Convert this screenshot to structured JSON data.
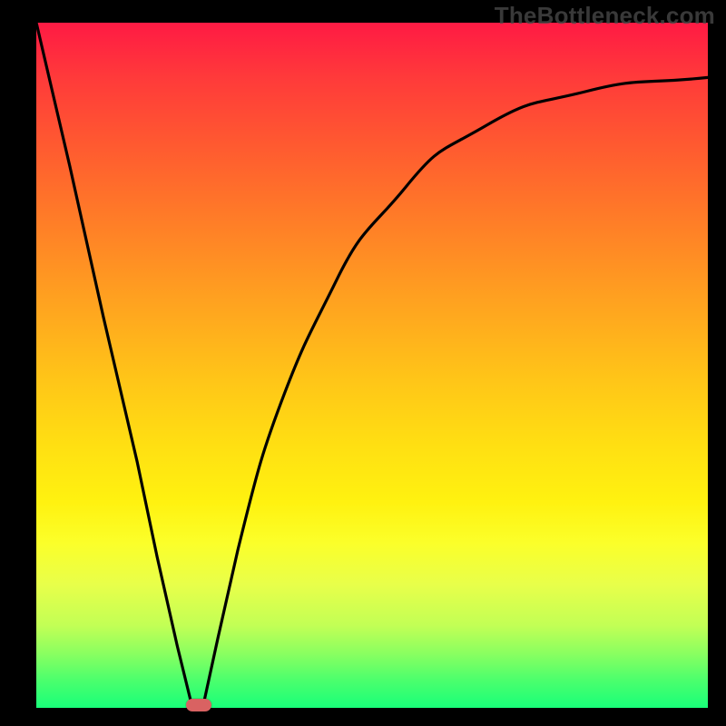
{
  "watermark": "TheBottleneck.com",
  "chart_data": {
    "type": "line",
    "title": "",
    "xlabel": "",
    "ylabel": "",
    "xlim": [
      0,
      1
    ],
    "ylim": [
      0,
      1
    ],
    "x": [
      0.0,
      0.05,
      0.1,
      0.15,
      0.18,
      0.21,
      0.23,
      0.25,
      0.27,
      0.3,
      0.33,
      0.37,
      0.41,
      0.45,
      0.5,
      0.55,
      0.6,
      0.67,
      0.74,
      0.82,
      0.9,
      1.0
    ],
    "values": [
      1.0,
      0.79,
      0.57,
      0.36,
      0.22,
      0.09,
      0.01,
      0.01,
      0.1,
      0.23,
      0.35,
      0.46,
      0.55,
      0.63,
      0.7,
      0.76,
      0.81,
      0.85,
      0.88,
      0.9,
      0.91,
      0.92
    ],
    "minimum_point": {
      "x": 0.24,
      "y": 0.0
    },
    "curve_description": "V-shaped curve: steep linear descent from top-left to a sharp minimum near x≈0.24 at bottom, then concave rise asymptotically approaching y≈0.92 toward the right edge.",
    "background": "vertical gradient red→orange→yellow→green (top to bottom)",
    "marker": {
      "shape": "rounded-rectangle",
      "color": "#d96262",
      "at": "minimum"
    }
  },
  "colors": {
    "curve": "#000000",
    "frame": "#000000",
    "marker": "#d96262",
    "watermark": "#4a4a4a"
  }
}
